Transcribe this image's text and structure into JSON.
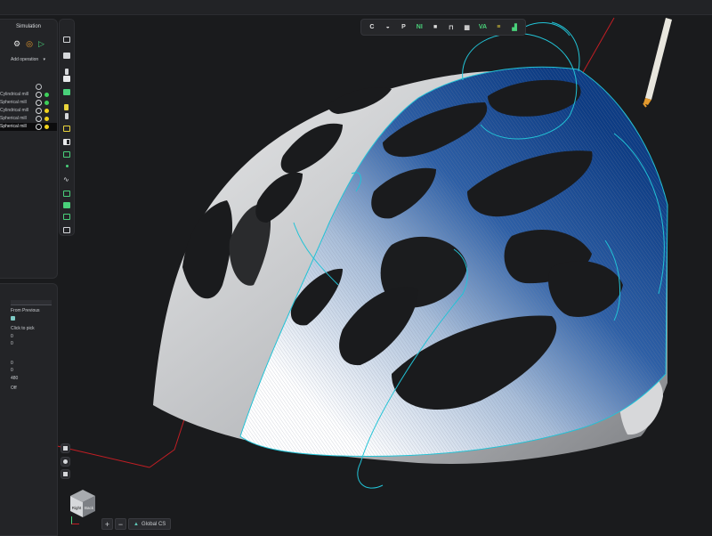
{
  "operations_panel": {
    "title": "Simulation",
    "add_operation_label": "Add operation",
    "operations": [
      {
        "label": "Cylindrical mill",
        "status_color": "#3ecf5a",
        "selected": false
      },
      {
        "label": "Spherical mill",
        "status_color": "#3ecf5a",
        "selected": false
      },
      {
        "label": "Cylindrical mill",
        "status_color": "#f0d21d",
        "selected": false
      },
      {
        "label": "Spherical mill",
        "status_color": "#f0d21d",
        "selected": false
      },
      {
        "label": "Spherical mill",
        "status_color": "#f0d21d",
        "selected": true
      }
    ]
  },
  "properties_panel": {
    "from_previous_label": "From Previous",
    "click_to_pick_label": "Click to pick",
    "values": [
      "0",
      "0",
      "0",
      "0",
      "480"
    ],
    "off_label": "Off"
  },
  "view_cube": {
    "left_face": "Right",
    "right_face": "Back"
  },
  "statusbar": {
    "add_label": "+",
    "minus_label": "−",
    "coordinate_system": "Global CS"
  },
  "top_toolbar": {
    "tools": [
      {
        "name": "ci-icon",
        "glyph": "C",
        "color": "#e6e6e6"
      },
      {
        "name": "sphere-tool-icon",
        "glyph": "◒",
        "color": "#dcdcdc"
      },
      {
        "name": "p-tool-icon",
        "glyph": "P",
        "color": "#dcdcdc"
      },
      {
        "name": "nl-tool-icon",
        "glyph": "NI",
        "color": "#49d17a"
      },
      {
        "name": "square-tool-icon",
        "glyph": "■",
        "color": "#dcdcdc"
      },
      {
        "name": "fixture-tool-icon",
        "glyph": "⊓",
        "color": "#dcdcdc"
      },
      {
        "name": "grid-tool-icon",
        "glyph": "▦",
        "color": "#dcdcdc"
      },
      {
        "name": "va-tool-icon",
        "glyph": "VA",
        "color": "#49d17a"
      },
      {
        "name": "layers-tool-icon",
        "glyph": "≡",
        "color": "#e9d43b"
      },
      {
        "name": "chart-tool-icon",
        "glyph": "▟",
        "color": "#49d17a"
      }
    ]
  },
  "colors": {
    "accent": "#5fc7b8",
    "toolpath_blue": "#1b4f99",
    "toolpath_cyan": "#22c3d6",
    "axis_red": "#c21e24"
  }
}
